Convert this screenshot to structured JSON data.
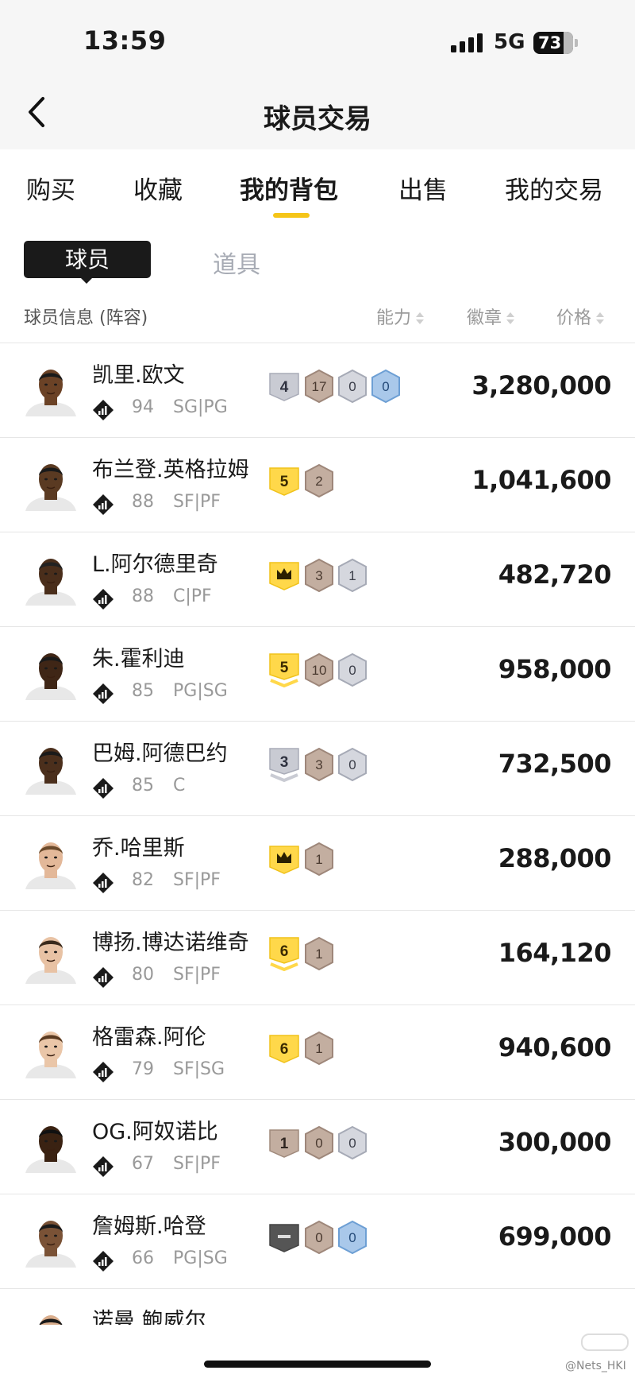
{
  "status_bar": {
    "time": "13:59",
    "network": "5G",
    "battery": "73"
  },
  "header": {
    "title": "球员交易"
  },
  "main_tabs": [
    {
      "label": "购买"
    },
    {
      "label": "收藏"
    },
    {
      "label": "我的背包",
      "active": true
    },
    {
      "label": "出售"
    },
    {
      "label": "我的交易"
    }
  ],
  "sub_tabs": [
    {
      "label": "球员",
      "active": true
    },
    {
      "label": "道具"
    }
  ],
  "columns": {
    "info": "球员信息 (阵容)",
    "ability": "能力",
    "badge": "徽章",
    "price": "价格"
  },
  "colors": {
    "accent": "#f5c518",
    "text": "#1a1a1a",
    "muted": "#999999"
  },
  "players": [
    {
      "name": "凯里.欧文",
      "rating": "94",
      "position": "SG|PG",
      "price": "3,280,000",
      "ability": {
        "type": "silver",
        "label": "4"
      },
      "badges": [
        {
          "type": "bronze",
          "label": "17"
        },
        {
          "type": "silver",
          "label": "0"
        },
        {
          "type": "blue",
          "label": "0"
        }
      ]
    },
    {
      "name": "布兰登.英格拉姆",
      "rating": "88",
      "position": "SF|PF",
      "price": "1,041,600",
      "ability": {
        "type": "gold",
        "label": "5"
      },
      "badges": [
        {
          "type": "bronze",
          "label": "2"
        }
      ]
    },
    {
      "name": "L.阿尔德里奇",
      "rating": "88",
      "position": "C|PF",
      "price": "482,720",
      "ability": {
        "type": "gold-crown",
        "label": ""
      },
      "badges": [
        {
          "type": "bronze",
          "label": "3"
        },
        {
          "type": "silver",
          "label": "1"
        }
      ]
    },
    {
      "name": "朱.霍利迪",
      "rating": "85",
      "position": "PG|SG",
      "price": "958,000",
      "ability": {
        "type": "gold-chevron",
        "label": "5"
      },
      "badges": [
        {
          "type": "bronze",
          "label": "10"
        },
        {
          "type": "silver",
          "label": "0"
        }
      ]
    },
    {
      "name": "巴姆.阿德巴约",
      "rating": "85",
      "position": "C",
      "price": "732,500",
      "ability": {
        "type": "silver-chevron",
        "label": "3"
      },
      "badges": [
        {
          "type": "bronze",
          "label": "3"
        },
        {
          "type": "silver",
          "label": "0"
        }
      ]
    },
    {
      "name": "乔.哈里斯",
      "rating": "82",
      "position": "SF|PF",
      "price": "288,000",
      "ability": {
        "type": "gold-crown",
        "label": ""
      },
      "badges": [
        {
          "type": "bronze",
          "label": "1"
        }
      ]
    },
    {
      "name": "博扬.博达诺维奇",
      "rating": "80",
      "position": "SF|PF",
      "price": "164,120",
      "ability": {
        "type": "gold-chevron",
        "label": "6"
      },
      "badges": [
        {
          "type": "bronze",
          "label": "1"
        }
      ]
    },
    {
      "name": "格雷森.阿伦",
      "rating": "79",
      "position": "SF|SG",
      "price": "940,600",
      "ability": {
        "type": "gold",
        "label": "6"
      },
      "badges": [
        {
          "type": "bronze",
          "label": "1"
        }
      ]
    },
    {
      "name": "OG.阿奴诺比",
      "rating": "67",
      "position": "SF|PF",
      "price": "300,000",
      "ability": {
        "type": "bronze",
        "label": "1"
      },
      "badges": [
        {
          "type": "bronze",
          "label": "0"
        },
        {
          "type": "silver",
          "label": "0"
        }
      ]
    },
    {
      "name": "詹姆斯.哈登",
      "rating": "66",
      "position": "PG|SG",
      "price": "699,000",
      "ability": {
        "type": "dark",
        "label": ""
      },
      "badges": [
        {
          "type": "bronze",
          "label": "0"
        },
        {
          "type": "blue",
          "label": "0"
        }
      ]
    },
    {
      "name": "诺曼.鲍威尔",
      "rating": "",
      "position": "",
      "price": "",
      "ability": null,
      "badges": []
    }
  ],
  "watermark": "@Nets_HKI"
}
